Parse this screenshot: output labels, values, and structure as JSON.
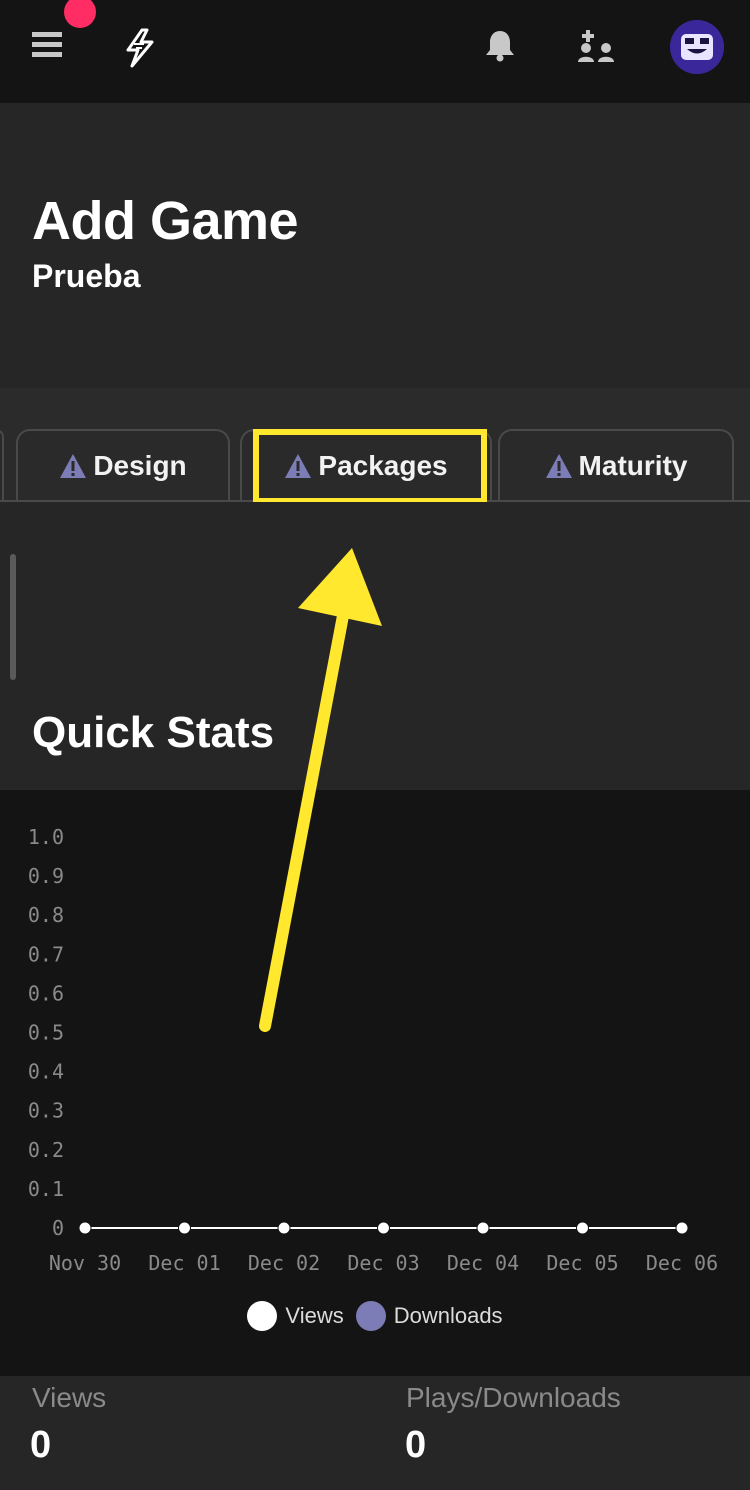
{
  "header": {
    "title": "Add Game",
    "subtitle": "Prueba"
  },
  "topbar": {
    "icons": [
      "menu-icon",
      "logo-icon",
      "bell-icon",
      "friends-icon",
      "avatar-icon"
    ]
  },
  "tabs": [
    {
      "label": "Design",
      "icon": "warning-icon"
    },
    {
      "label": "Packages",
      "icon": "warning-icon",
      "highlighted": true
    },
    {
      "label": "Maturity",
      "icon": "warning-icon"
    }
  ],
  "quick_stats": {
    "title": "Quick Stats"
  },
  "chart_data": {
    "type": "line",
    "x": [
      "Nov 30",
      "Dec 01",
      "Dec 02",
      "Dec 03",
      "Dec 04",
      "Dec 05",
      "Dec 06"
    ],
    "yticks": [
      "0",
      "0.1",
      "0.2",
      "0.3",
      "0.4",
      "0.5",
      "0.6",
      "0.7",
      "0.8",
      "0.9",
      "1.0"
    ],
    "ylim": [
      0,
      1.0
    ],
    "series": [
      {
        "name": "Views",
        "values": [
          0,
          0,
          0,
          0,
          0,
          0,
          0
        ],
        "color": "#ffffff"
      },
      {
        "name": "Downloads",
        "values": [
          0,
          0,
          0,
          0,
          0,
          0,
          0
        ],
        "color": "#7c7cb6"
      }
    ],
    "legend": "bottom-center"
  },
  "stats": {
    "views_label": "Views",
    "views_value": "0",
    "plays_label": "Plays/Downloads",
    "plays_value": "0"
  },
  "colors": {
    "highlight": "#ffe82e",
    "notification": "#ff2d63",
    "warning": "#7c7cb6"
  }
}
